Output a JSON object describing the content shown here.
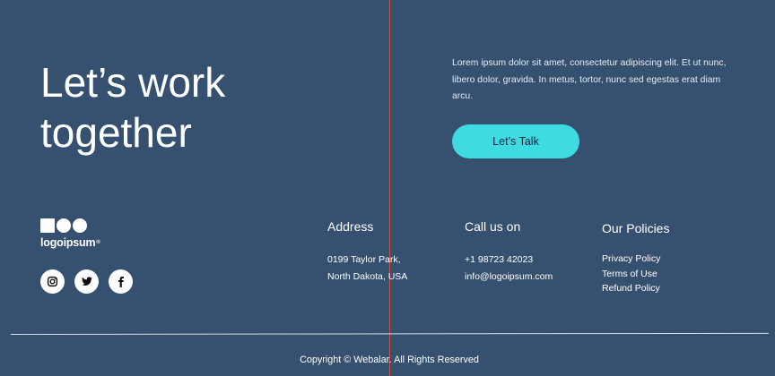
{
  "hero": {
    "headline_line1": "Let’s work",
    "headline_line2": "together",
    "intro": "Lorem ipsum dolor sit amet, consectetur adipiscing elit. Et ut nunc, libero dolor, gravida. In metus, tortor, nunc sed egestas erat diam arcu.",
    "cta_label": "Let’s Talk"
  },
  "brand": {
    "logo_text": "logoipsum",
    "logo_mark": "®"
  },
  "socials": [
    {
      "name": "instagram",
      "icon": "instagram-icon"
    },
    {
      "name": "twitter",
      "icon": "twitter-icon"
    },
    {
      "name": "facebook",
      "icon": "facebook-icon"
    }
  ],
  "address": {
    "title": "Address",
    "lines": [
      "0199 Taylor Park,",
      "North Dakota, USA"
    ]
  },
  "call": {
    "title": "Call us on",
    "phone": "+1 98723 42023",
    "email": "info@logoipsum.com"
  },
  "policies": {
    "title": "Our Policies",
    "links": [
      "Privacy Policy",
      "Terms of Use",
      "Refund Policy"
    ]
  },
  "footer": {
    "copyright": "Copyright © Webalar. All Rights Reserved"
  },
  "colors": {
    "background": "#35516f",
    "accent": "#3fdbe3",
    "guide_line": "#c8514a"
  }
}
